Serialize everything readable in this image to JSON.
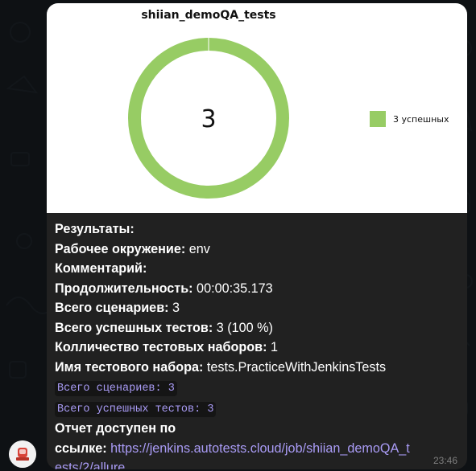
{
  "message": {
    "time": "23:46",
    "results_title": "Результаты:",
    "lines": [
      {
        "label": "Рабочее окружение:",
        "value": "env"
      },
      {
        "label": "Комментарий:",
        "value": ""
      },
      {
        "label": "Продолжительность:",
        "value": "00:00:35.173"
      },
      {
        "label": "Всего сценариев:",
        "value": "3"
      },
      {
        "label": "Всего успешных тестов:",
        "value": "3 (100 %)"
      },
      {
        "label": "Колличество тестовых наборов:",
        "value": "1"
      },
      {
        "label": "Имя тестового набора:",
        "value": "tests.PracticeWithJenkinsTests"
      }
    ],
    "code_lines": [
      "Всего сценариев: 3",
      "Всего успешных тестов: 3"
    ],
    "report_label_1": "Отчет доступен по",
    "report_label_2": "ссылке:",
    "report_link_1": "https://jenkins.autotests.cloud/job/shiian_demoQA_t",
    "report_link_2": "ests/2/allure"
  },
  "chart_data": {
    "type": "pie",
    "title": "shiian_demoQA_tests",
    "center_label": "3",
    "slices": [
      {
        "name": "3 успешных",
        "value": 3,
        "color": "#97cc64"
      }
    ],
    "legend_position": "right"
  },
  "colors": {
    "chat_background": "#0e1114",
    "bubble": "#212121",
    "link": "#a99bf5",
    "success": "#97cc64"
  },
  "icons": {
    "avatar": "jenkins-avatar-icon"
  }
}
